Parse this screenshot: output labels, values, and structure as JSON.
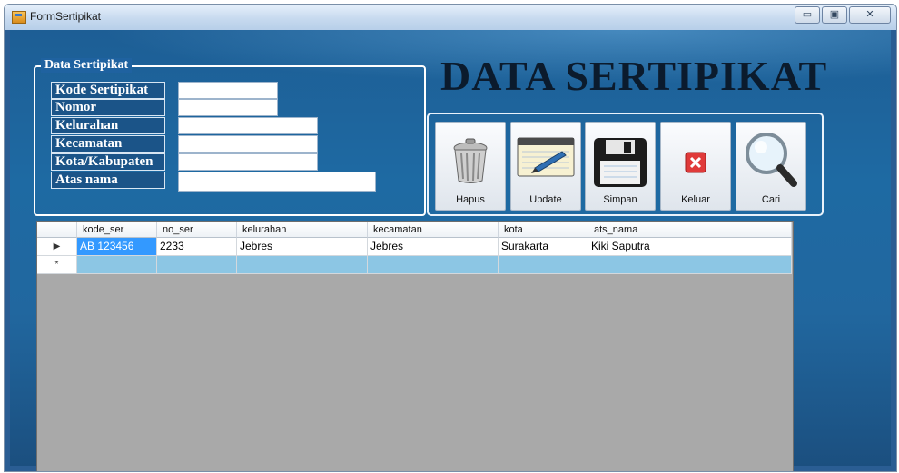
{
  "window": {
    "title": "FormSertipikat",
    "minimize": "▭",
    "maximize": "▣",
    "close": "✕"
  },
  "heading": "DATA SERTIPIKAT",
  "form": {
    "legend": "Data Sertipikat",
    "fields": [
      {
        "label": "Kode Sertipikat",
        "value": ""
      },
      {
        "label": "Nomor",
        "value": ""
      },
      {
        "label": "Kelurahan",
        "value": ""
      },
      {
        "label": "Kecamatan",
        "value": ""
      },
      {
        "label": "Kota/Kabupaten",
        "value": ""
      },
      {
        "label": "Atas nama",
        "value": ""
      }
    ]
  },
  "buttons": [
    {
      "label": "Hapus",
      "icon": "trash-icon"
    },
    {
      "label": "Update",
      "icon": "notepad-icon"
    },
    {
      "label": "Simpan",
      "icon": "floppy-disk-icon"
    },
    {
      "label": "Keluar",
      "icon": "close-icon"
    },
    {
      "label": "Cari",
      "icon": "magnifier-icon"
    }
  ],
  "grid": {
    "columns": [
      "kode_ser",
      "no_ser",
      "kelurahan",
      "kecamatan",
      "kota",
      "ats_nama"
    ],
    "rows": [
      {
        "marker": "▶",
        "cells": [
          "AB 123456",
          "2233",
          "Jebres",
          "Jebres",
          "Surakarta",
          "Kiki Saputra"
        ]
      }
    ],
    "new_row_marker": "*"
  },
  "colors": {
    "client_blue": "#1e6aa3",
    "grid_gray": "#a9a9a9",
    "selection": "#3399ff",
    "new_row": "#8cc6e4"
  }
}
